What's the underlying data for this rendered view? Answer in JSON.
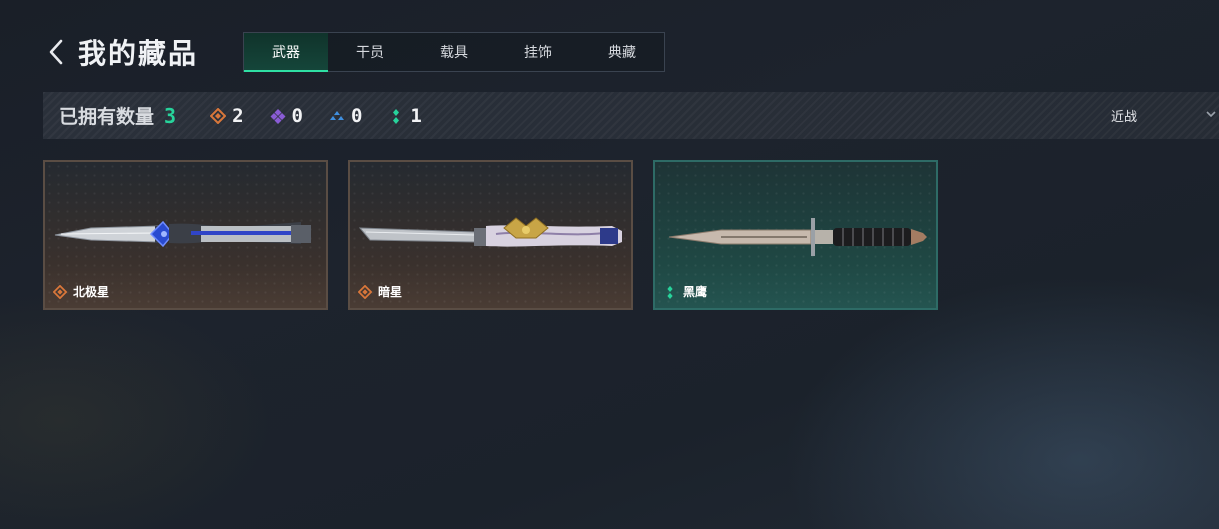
{
  "header": {
    "title": "我的藏品",
    "back_icon": "chevron-left-icon"
  },
  "tabs": [
    {
      "label": "武器",
      "active": true
    },
    {
      "label": "干员",
      "active": false
    },
    {
      "label": "载具",
      "active": false
    },
    {
      "label": "挂饰",
      "active": false
    },
    {
      "label": "典藏",
      "active": false
    }
  ],
  "summary": {
    "owned_label": "已拥有数量",
    "owned_count": "3",
    "rarities": [
      {
        "icon": "orange-diamond-icon",
        "color": "#d9773a",
        "count": "2"
      },
      {
        "icon": "purple-diamond-icon",
        "color": "#8a5cd6",
        "count": "0"
      },
      {
        "icon": "blue-triangle-icon",
        "color": "#3f8fe0",
        "count": "0"
      },
      {
        "icon": "green-dots-icon",
        "color": "#27d39b",
        "count": "1"
      }
    ]
  },
  "sort": {
    "label": "近战",
    "icon": "chevron-down-icon"
  },
  "items": [
    {
      "name": "北极星",
      "rarity_icon": "orange-diamond-icon",
      "rarity_color": "#d9773a"
    },
    {
      "name": "暗星",
      "rarity_icon": "orange-diamond-icon",
      "rarity_color": "#d9773a"
    },
    {
      "name": "黑鹰",
      "rarity_icon": "green-dots-icon",
      "rarity_color": "#27d39b"
    }
  ],
  "colors": {
    "accent": "#27d39b",
    "active_tab": "#15463a",
    "orange_border": "#5a4d44",
    "green_border": "#2e6b66"
  }
}
